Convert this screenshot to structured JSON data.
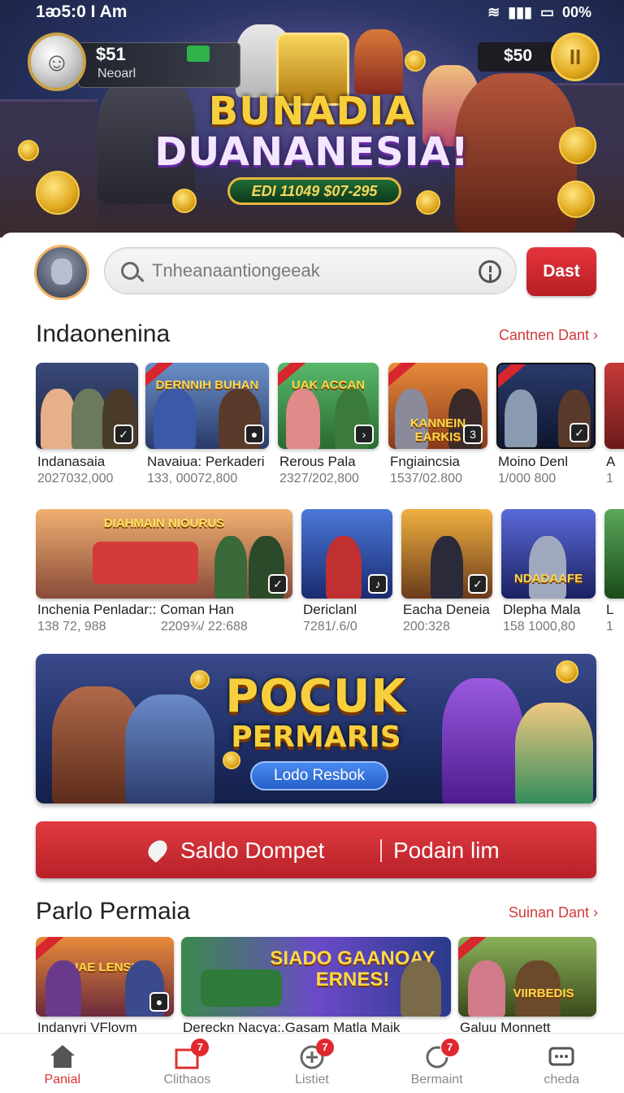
{
  "status_bar": {
    "time": "1ᴔ5:0 I Am",
    "battery": "00%"
  },
  "hero": {
    "wallet_left_amount": "$51",
    "wallet_left_label": "Neoarl",
    "wallet_right_amount": "$50",
    "title_line1": "BUNADIA",
    "title_line2": "DUANANESIA!",
    "pill_text": "EDI 11049 $07-295"
  },
  "search": {
    "placeholder": "Tnheanaantiongeeak",
    "button_label": "Dast"
  },
  "section1": {
    "title": "Indaonenina",
    "link": "Cantnen Dant ›",
    "row1": [
      {
        "name": "Indanasaia",
        "count": "2027032,000",
        "thumb_text": ""
      },
      {
        "name": "Navaiua: Perkaderi",
        "count": "133, 00072,800",
        "thumb_text": "DERNNIH BUHAN"
      },
      {
        "name": "Rerous Pala",
        "count": "2327/202,800",
        "thumb_text": "UAK ACCAN"
      },
      {
        "name": "Fngiaincsia",
        "count": "1537/02.800",
        "thumb_text": "KANNEIN EARKIS"
      },
      {
        "name": "Moino Denl",
        "count": "1/000 800",
        "thumb_text": ""
      },
      {
        "name": "A",
        "count": "1",
        "thumb_text": ""
      }
    ],
    "row2": [
      {
        "name": "Inchenia Penladar:: Coman Han",
        "count": "138 72, 988",
        "count2": "2209¾/ 22:688",
        "thumb_text": "DIAHMAIN NIOURUS"
      },
      {
        "name": "Dericlanl",
        "count": "7281/.6/0",
        "thumb_text": ""
      },
      {
        "name": "Eacha Deneia",
        "count": "200:328",
        "thumb_text": ""
      },
      {
        "name": "Dlepha Mala",
        "count": "158 1000,80",
        "thumb_text": "NDADAAFE"
      },
      {
        "name": "L",
        "count": "1",
        "thumb_text": ""
      }
    ]
  },
  "promo": {
    "title1": "POCUK",
    "title2": "PERMARIS",
    "button": "Lodo Resbok"
  },
  "wallet_bar": {
    "label1": "Saldo Dompet",
    "label2": "Podain lim"
  },
  "section2": {
    "title": "Parlo Permaia",
    "link": "Suinan Dant ›",
    "row": [
      {
        "name": "Indanyri VFlovm",
        "thumb_text": "UAE LENSH"
      },
      {
        "name": "Dereckn Nacya:.Gasam Matla Maik",
        "thumb_text": "SIADO GAANOAY ERNES!"
      },
      {
        "name": "Galuu Monnett",
        "thumb_text": "VIIRBEDIS"
      }
    ]
  },
  "bottom_nav": [
    {
      "label": "Panial",
      "icon": "home-icon",
      "badge": ""
    },
    {
      "label": "Clithaos",
      "icon": "gift-icon",
      "badge": "7"
    },
    {
      "label": "Listiet",
      "icon": "add-circle-icon",
      "badge": "7"
    },
    {
      "label": "Bermaint",
      "icon": "refresh-icon",
      "badge": "7"
    },
    {
      "label": "cheda",
      "icon": "chat-icon",
      "badge": ""
    }
  ],
  "colors": {
    "accent_red": "#d8262f",
    "link_red": "#d23a3a",
    "gold": "#f7cf3d"
  }
}
